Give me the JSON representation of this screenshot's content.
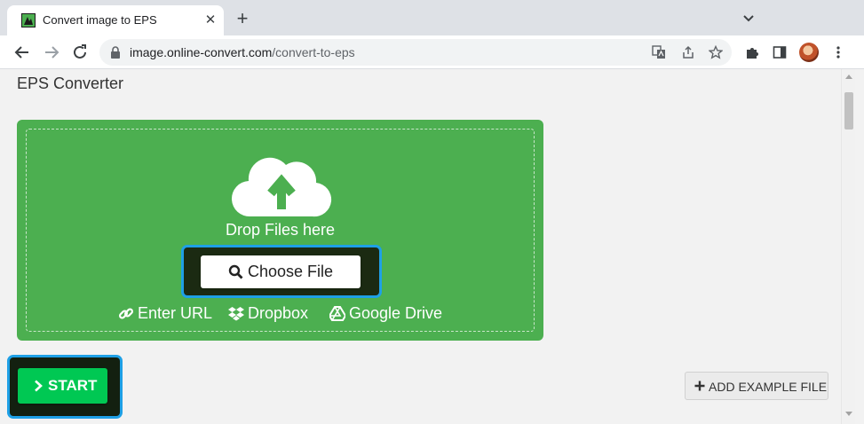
{
  "browser": {
    "tab": {
      "title": "Convert image to EPS",
      "close_glyph": "✕"
    },
    "new_tab_glyph": "+",
    "address": {
      "domain": "image.online-convert.com",
      "path": "/convert-to-eps"
    },
    "icons": {
      "back": "back-arrow-icon",
      "forward": "forward-arrow-icon",
      "reload": "reload-icon",
      "lock": "lock-icon",
      "translate": "translate-icon",
      "share": "share-icon",
      "bookmark": "star-icon",
      "extensions": "puzzle-icon",
      "sidepanel": "side-panel-icon",
      "menu": "kebab-menu-icon"
    }
  },
  "page": {
    "title": "EPS Converter",
    "upload": {
      "drop_text": "Drop Files here",
      "choose_file_label": "Choose File",
      "links": [
        {
          "label": "Enter URL",
          "icon": "link-icon"
        },
        {
          "label": "Dropbox",
          "icon": "dropbox-icon"
        },
        {
          "label": "Google Drive",
          "icon": "google-drive-icon"
        }
      ]
    },
    "start_label": "START",
    "add_example_label": "ADD EXAMPLE FILE"
  },
  "colors": {
    "upload_green": "#4caf50",
    "start_green": "#00c853",
    "highlight_blue": "#1ea0e6"
  }
}
